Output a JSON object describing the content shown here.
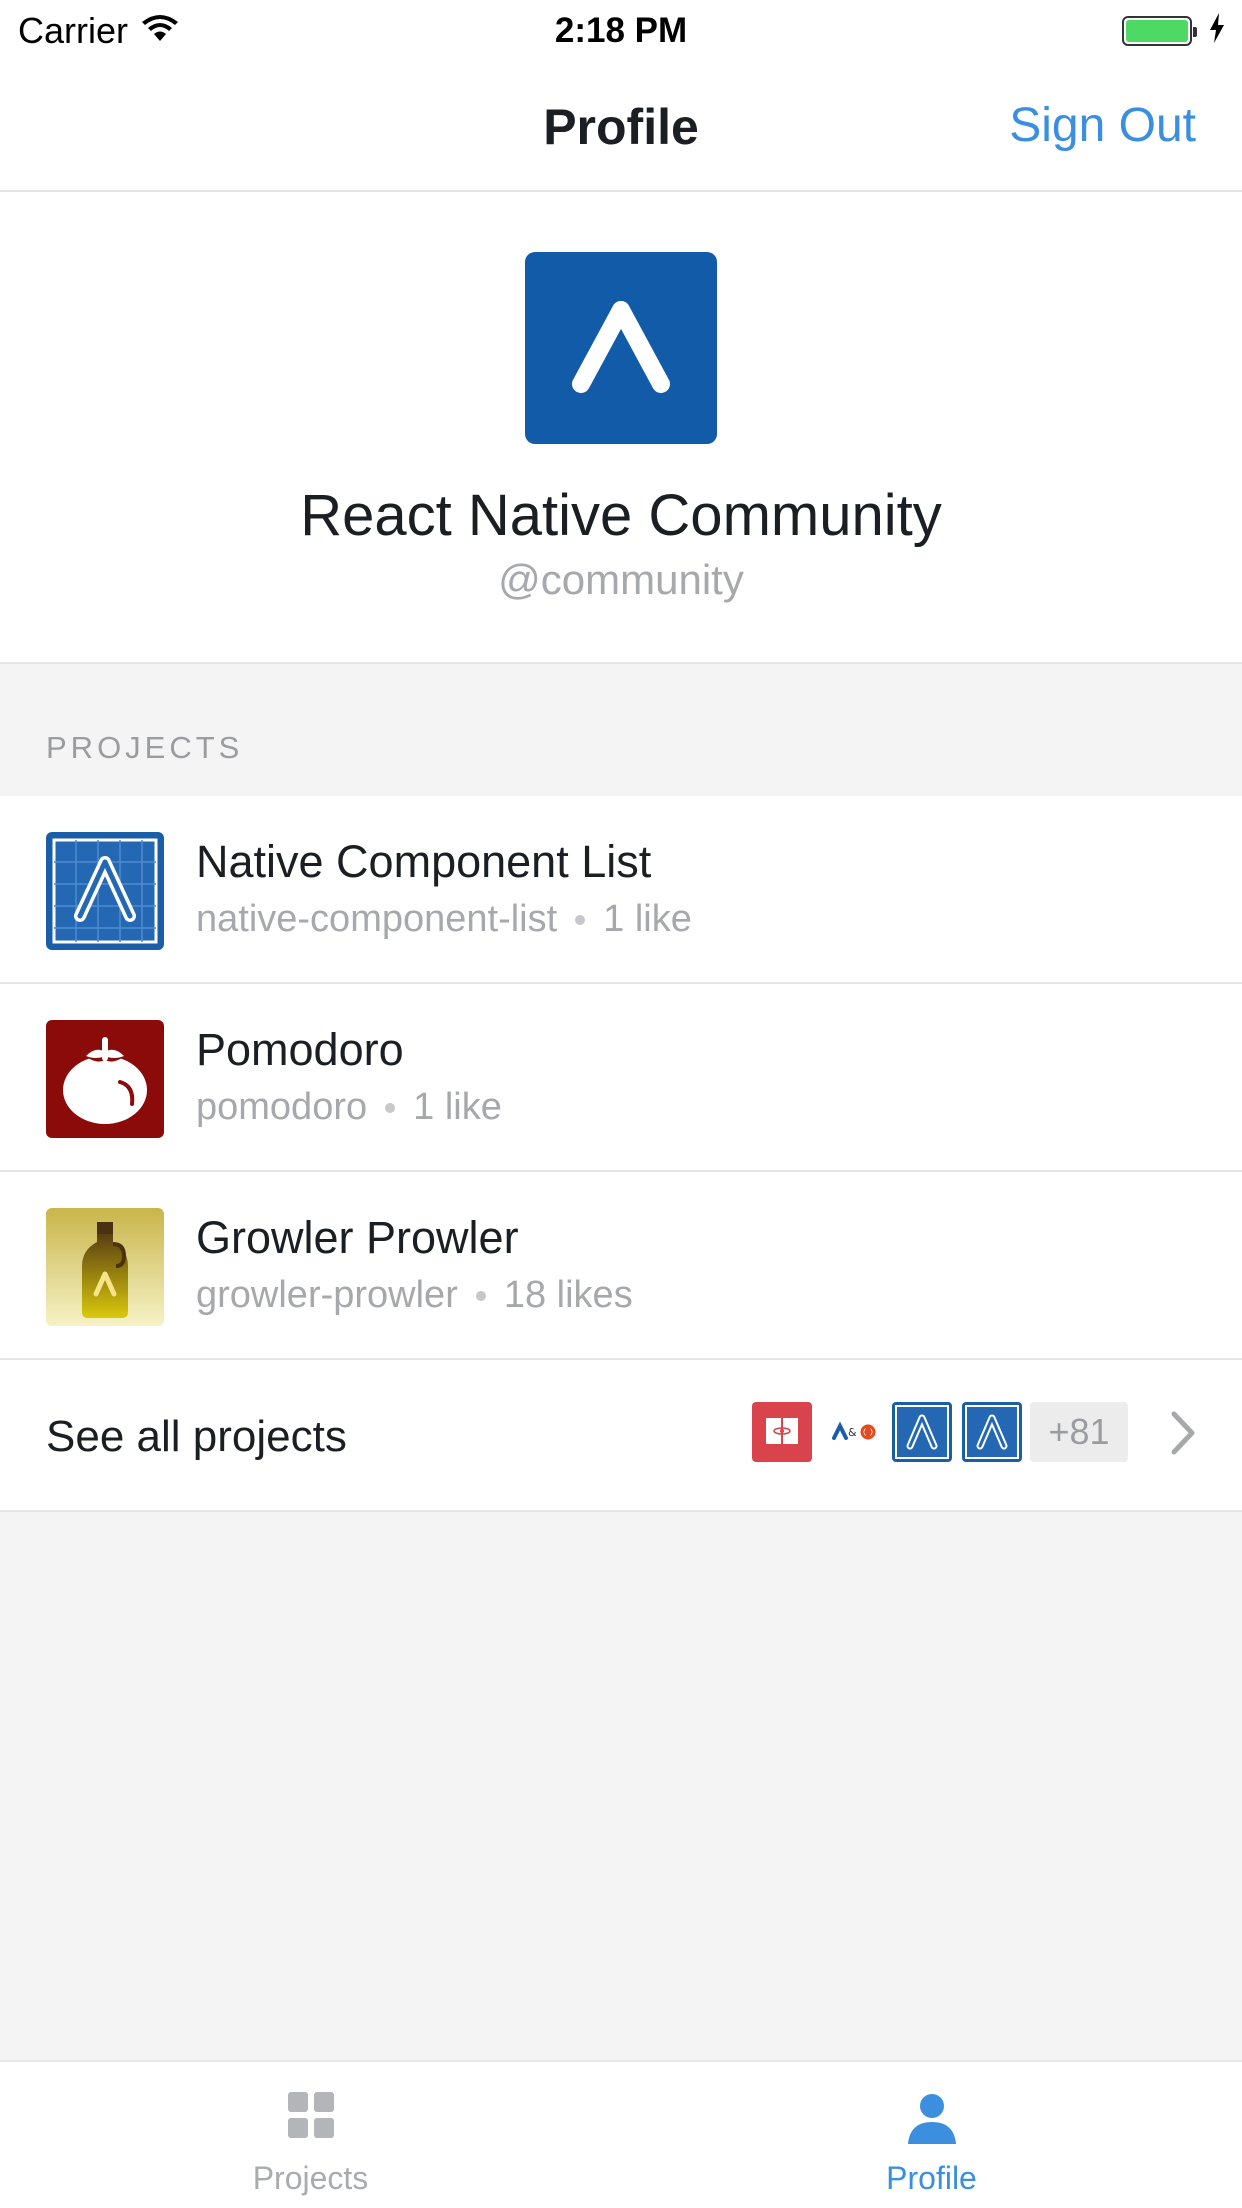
{
  "status_bar": {
    "carrier": "Carrier",
    "time": "2:18 PM"
  },
  "nav": {
    "title": "Profile",
    "sign_out": "Sign Out"
  },
  "profile": {
    "name": "React Native Community",
    "username": "@community",
    "avatar_color": "#125ba9"
  },
  "projects_section": {
    "title": "PROJECTS",
    "items": [
      {
        "name": "Native Component List",
        "slug": "native-component-list",
        "likes": "1 like",
        "icon": "expo-blueprint-icon"
      },
      {
        "name": "Pomodoro",
        "slug": "pomodoro",
        "likes": "1 like",
        "icon": "tomato-icon"
      },
      {
        "name": "Growler Prowler",
        "slug": "growler-prowler",
        "likes": "18 likes",
        "icon": "growler-bottle-icon"
      }
    ],
    "see_all": {
      "label": "See all projects",
      "more_count": "+81"
    }
  },
  "tabs": [
    {
      "label": "Projects",
      "icon": "grid-icon",
      "active": false
    },
    {
      "label": "Profile",
      "icon": "person-icon",
      "active": true
    }
  ],
  "colors": {
    "accent": "#3b8fde",
    "expo_blue": "#125ba9",
    "pomodoro_red": "#8b0a0a",
    "battery_green": "#4cd964"
  }
}
